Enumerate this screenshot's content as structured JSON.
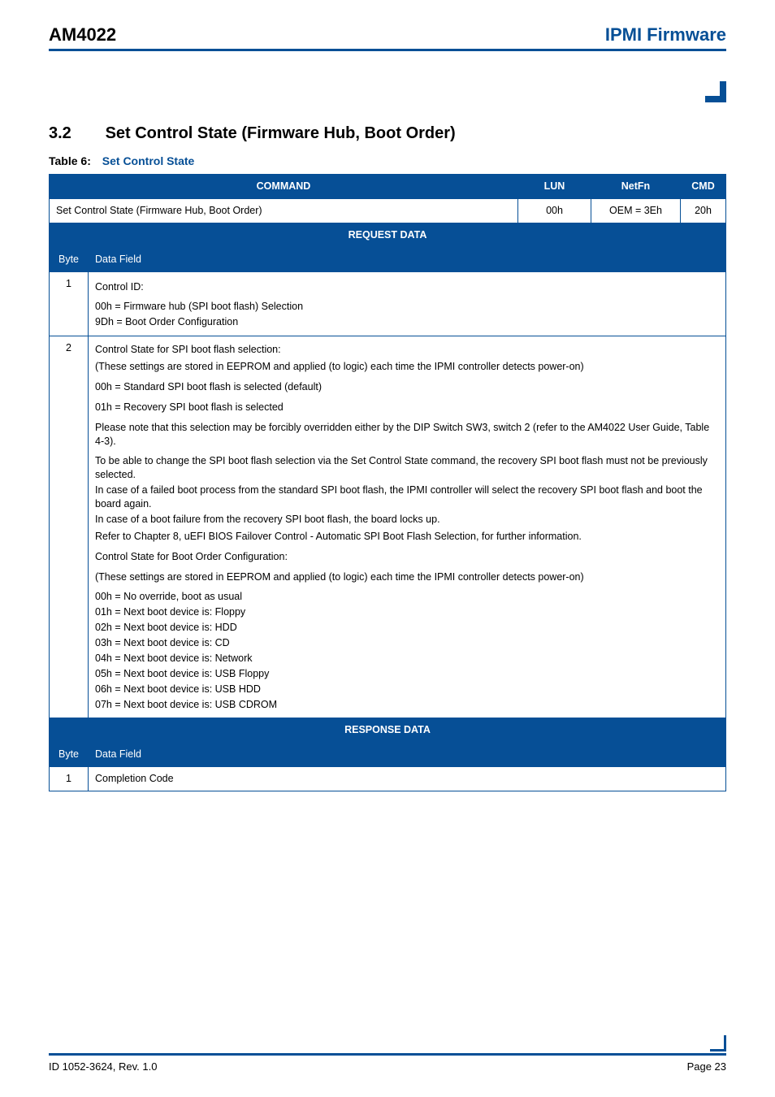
{
  "header": {
    "left": "AM4022",
    "right": "IPMI Firmware"
  },
  "section": {
    "number": "3.2",
    "title": "Set Control State (Firmware Hub, Boot Order)"
  },
  "table_caption": {
    "label": "Table 6:",
    "title": "Set Control State"
  },
  "cmd_header": {
    "c0": "COMMAND",
    "c1": "LUN",
    "c2": "NetFn",
    "c3": "CMD"
  },
  "cmd_row": {
    "c0": "Set Control State (Firmware Hub, Boot Order)",
    "c1": "00h",
    "c2": "OEM = 3Eh",
    "c3": "20h"
  },
  "request_data_label": "REQUEST DATA",
  "sub_header": {
    "c0": "Byte",
    "c1": "Data Field"
  },
  "req_row1": {
    "byte": "1",
    "l0": "Control ID:",
    "l1": "00h = Firmware hub (SPI boot flash) Selection",
    "l2": "9Dh = Boot Order Configuration"
  },
  "req_row2": {
    "byte": "2",
    "p0": "Control State for SPI boot flash selection:",
    "p1": "(These settings are stored in EEPROM and applied (to logic) each time the IPMI controller detects power-on)",
    "p2": "00h = Standard SPI boot flash is selected (default)",
    "p3": "01h = Recovery SPI boot flash is selected",
    "p4": "Please note that this selection may be forcibly overridden either by the DIP Switch SW3, switch 2 (refer to the AM4022 User Guide, Table 4-3).",
    "p5": "To be able to change the SPI boot flash selection via the Set Control State command, the recovery SPI boot flash must not be previously selected.",
    "p6": "In case of a failed boot process from the standard SPI boot flash, the IPMI controller will select the recovery SPI boot flash and boot the board again.",
    "p7": "In case of a boot failure from the recovery SPI boot flash, the board locks up.",
    "p8": "Refer to Chapter 8, uEFI BIOS Failover Control - Automatic SPI Boot Flash Selection, for further information.",
    "p9": "Control State for Boot Order Configuration:",
    "p10": "(These settings are stored in EEPROM and applied (to logic) each time the IPMI controller detects power-on)",
    "b0": "00h = No override, boot as usual",
    "b1": "01h = Next boot device is: Floppy",
    "b2": "02h = Next boot device is: HDD",
    "b3": "03h = Next boot device is: CD",
    "b4": "04h = Next boot device is: Network",
    "b5": "05h = Next boot device is: USB Floppy",
    "b6": "06h = Next boot device is: USB HDD",
    "b7": "07h = Next boot device is: USB CDROM"
  },
  "response_data_label": "RESPONSE DATA",
  "resp_row1": {
    "byte": "1",
    "data": "Completion Code"
  },
  "footer": {
    "left": "ID 1052-3624, Rev. 1.0",
    "right": "Page 23"
  }
}
